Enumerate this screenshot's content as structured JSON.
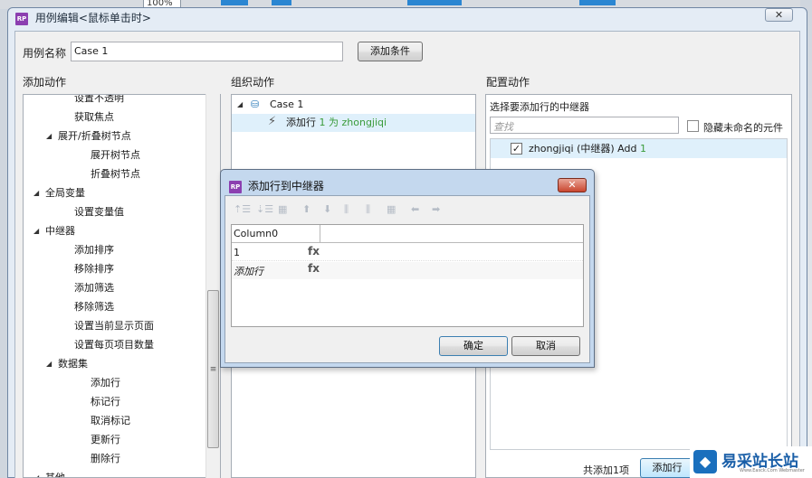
{
  "background": {
    "zoom": "100%"
  },
  "dialog": {
    "title": "用例编辑<鼠标单击时>",
    "close": "✕",
    "case_name_label": "用例名称",
    "case_name_value": "Case 1",
    "add_condition": "添加条件"
  },
  "left_panel": {
    "header": "添加动作",
    "items": [
      {
        "label": "设置不透明",
        "level": 2
      },
      {
        "label": "获取焦点",
        "level": 2
      },
      {
        "label": "展开/折叠树节点",
        "level": 1,
        "expanded": true
      },
      {
        "label": "展开树节点",
        "level": 3
      },
      {
        "label": "折叠树节点",
        "level": 3
      },
      {
        "label": "全局变量",
        "level": 0,
        "expanded": true
      },
      {
        "label": "设置变量值",
        "level": 2
      },
      {
        "label": "中继器",
        "level": 0,
        "expanded": true
      },
      {
        "label": "添加排序",
        "level": 2
      },
      {
        "label": "移除排序",
        "level": 2
      },
      {
        "label": "添加筛选",
        "level": 2
      },
      {
        "label": "移除筛选",
        "level": 2
      },
      {
        "label": "设置当前显示页面",
        "level": 2
      },
      {
        "label": "设置每页项目数量",
        "level": 2
      },
      {
        "label": "数据集",
        "level": 1,
        "expanded": true
      },
      {
        "label": "添加行",
        "level": 3
      },
      {
        "label": "标记行",
        "level": 3
      },
      {
        "label": "取消标记",
        "level": 3
      },
      {
        "label": "更新行",
        "level": 3
      },
      {
        "label": "删除行",
        "level": 3
      },
      {
        "label": "其他",
        "level": 0,
        "expanded": true
      }
    ]
  },
  "middle_panel": {
    "header": "组织动作",
    "case_label": "Case 1",
    "action_prefix": "添加行 ",
    "action_detail": "1 为 zhongjiqi"
  },
  "right_panel": {
    "header": "配置动作",
    "subheader": "选择要添加行的中继器",
    "search_placeholder": "查找",
    "hide_unnamed": "隐藏未命名的元件",
    "item_name": "zhongjiqi (中继器) Add ",
    "item_count": "1",
    "total_label": "共添加1项",
    "add_button": "添加行"
  },
  "inner_dialog": {
    "title": "添加行到中继器",
    "close": "✕",
    "column_header": "Column0",
    "rows": [
      {
        "value": "1",
        "fx": "fx",
        "italic": false
      },
      {
        "value": "添加行",
        "fx": "fx",
        "italic": true
      }
    ],
    "ok": "确定",
    "cancel": "取消"
  },
  "watermark": {
    "text": "易采站长站",
    "sub": "Www.Easck.Com Webmaster"
  }
}
